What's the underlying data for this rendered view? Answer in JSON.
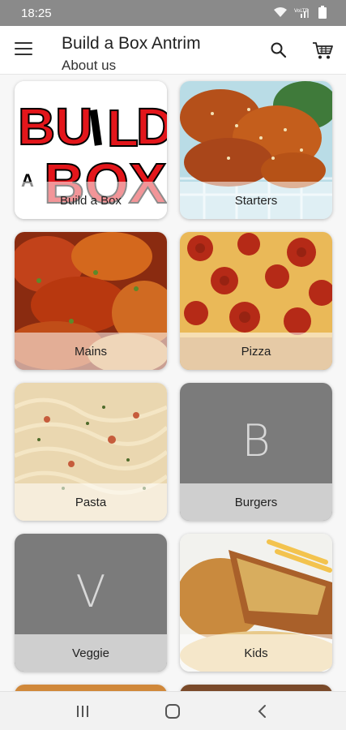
{
  "status_bar": {
    "time": "18:25",
    "icons": [
      "wifi-icon",
      "lte-signal-icon",
      "battery-icon"
    ]
  },
  "app_bar": {
    "title": "Build a Box Antrim",
    "subtitle": "About us",
    "icons": [
      "menu-icon",
      "search-icon",
      "cart-icon"
    ]
  },
  "categories": [
    {
      "label": "Build a Box"
    },
    {
      "label": "Starters"
    },
    {
      "label": "Mains"
    },
    {
      "label": "Pizza"
    },
    {
      "label": "Pasta"
    },
    {
      "label": "Burgers",
      "placeholder_letter": "B"
    },
    {
      "label": "Veggie",
      "placeholder_letter": "V"
    },
    {
      "label": "Kids"
    }
  ],
  "logo_text": "BUILD A BOX",
  "nav_bar": {
    "icons": [
      "recent-apps-icon",
      "home-icon",
      "back-icon"
    ]
  }
}
